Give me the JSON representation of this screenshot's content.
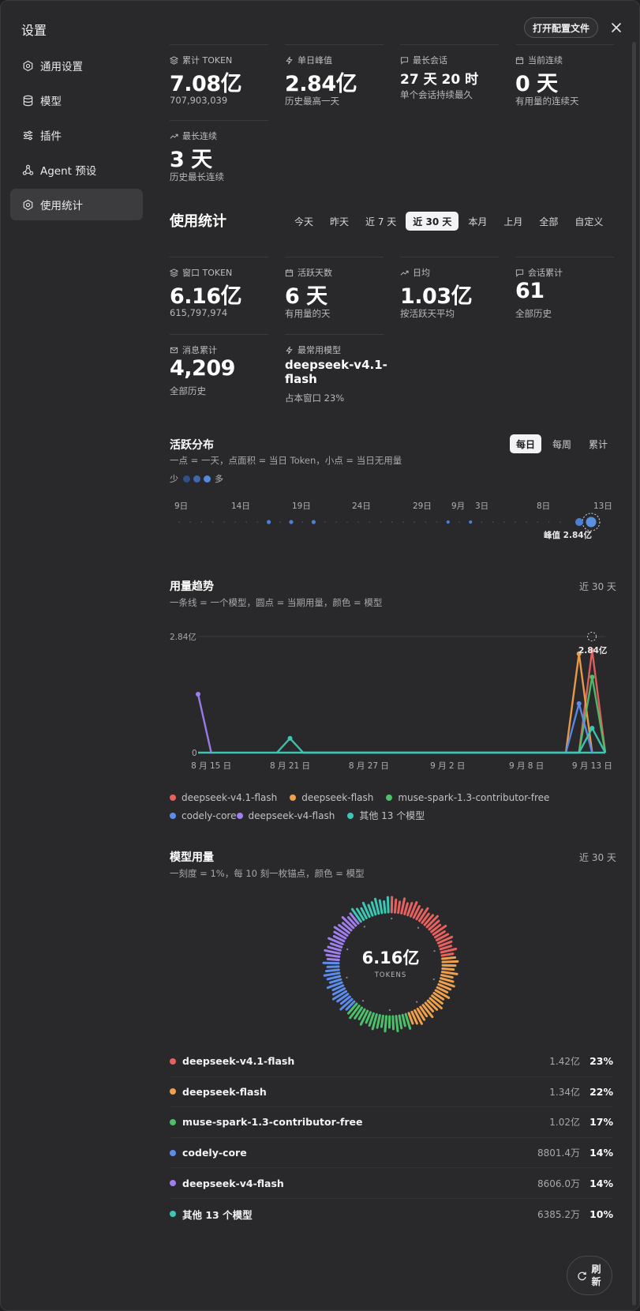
{
  "window": {
    "title": "设置",
    "open_config": "打开配置文件",
    "close_icon": "close-icon"
  },
  "sidebar": {
    "items": [
      {
        "label": "通用设置",
        "icon": "settings-icon",
        "active": false
      },
      {
        "label": "模型",
        "icon": "database-icon",
        "active": false
      },
      {
        "label": "插件",
        "icon": "sliders-icon",
        "active": false
      },
      {
        "label": "Agent 预设",
        "icon": "agent-icon",
        "active": false
      },
      {
        "label": "使用统计",
        "icon": "settings-icon",
        "active": true
      }
    ]
  },
  "totals": {
    "total_token": {
      "label": "累计 TOKEN",
      "value": "7.08亿",
      "sub": "707,903,039",
      "icon": "layers-icon"
    },
    "daily_peak": {
      "label": "单日峰值",
      "value": "2.84亿",
      "sub": "历史最高一天",
      "icon": "bolt-icon"
    },
    "longest_session": {
      "label": "最长会话",
      "value": "27 天 20 时",
      "sub": "单个会话持续最久",
      "icon": "chat-icon"
    },
    "current_streak": {
      "label": "当前连续",
      "value": "0 天",
      "sub": "有用量的连续天",
      "icon": "calendar-icon"
    },
    "longest_streak": {
      "label": "最长连续",
      "value": "3 天",
      "sub": "历史最长连续",
      "icon": "trend-icon"
    }
  },
  "usage": {
    "title": "使用统计",
    "ranges": [
      "今天",
      "昨天",
      "近 7 天",
      "近 30 天",
      "本月",
      "上月",
      "全部",
      "自定义"
    ],
    "active_range": "近 30 天",
    "window_token": {
      "label": "窗口 TOKEN",
      "value": "6.16亿",
      "sub": "615,797,974",
      "icon": "layers-icon"
    },
    "active_days": {
      "label": "活跃天数",
      "value": "6 天",
      "sub": "有用量的天",
      "icon": "calendar-icon"
    },
    "daily_avg": {
      "label": "日均",
      "value": "1.03亿",
      "sub": "按活跃天平均",
      "icon": "trend-icon"
    },
    "sessions": {
      "label": "会话累计",
      "value": "61",
      "sub": "全部历史",
      "icon": "chat-icon"
    },
    "messages": {
      "label": "消息累计",
      "value": "4,209",
      "sub": "全部历史",
      "icon": "mail-icon"
    },
    "top_model": {
      "label": "最常用模型",
      "value_line1": "deepseek-v4.1-",
      "value_line2": "flash",
      "sub": "占本窗口 23%",
      "icon": "bolt-icon"
    }
  },
  "activity": {
    "title": "活跃分布",
    "desc": "一点 = 一天，点面积 = 当日 Token，小点 = 当日无用量",
    "scale_less": "少",
    "scale_more": "多",
    "modes": [
      "每日",
      "每周",
      "累计"
    ],
    "active_mode": "每日",
    "ticks": [
      "9日",
      "14日",
      "19日",
      "24日",
      "29日",
      "9月",
      "3日",
      "8日",
      "13日"
    ],
    "peak_label": "峰值 2.84亿",
    "dot_color": "#4a7fd4"
  },
  "trend": {
    "title": "用量趋势",
    "desc": "一条线 = 一个模型，圆点 = 当期用量，颜色 = 模型",
    "range_note": "近 30 天",
    "y_top": "2.84亿",
    "y_zero": "0",
    "peak_label": "2.84亿",
    "legend": [
      {
        "name": "deepseek-v4.1-flash",
        "color": "#e8615f"
      },
      {
        "name": "deepseek-flash",
        "color": "#f0a04b"
      },
      {
        "name": "muse-spark-1.3-contributor-free",
        "color": "#4cc06b"
      },
      {
        "name": "codely-core",
        "color": "#5b8def"
      },
      {
        "name": "deepseek-v4-flash",
        "color": "#a07ef0"
      },
      {
        "name": "其他 13 个模型",
        "color": "#3cc7b4"
      }
    ]
  },
  "chart_data": {
    "type": "line",
    "x_labels": [
      "8 月 15 日",
      "8 月 21 日",
      "8 月 27 日",
      "9 月 2 日",
      "9 月 8 日",
      "9 月 13 日"
    ],
    "ylim": [
      0,
      284000000
    ],
    "series": [
      {
        "name": "deepseek-v4.1-flash",
        "color": "#e8615f",
        "points": [
          [
            "9 月 12 日",
            0
          ],
          [
            "9 月 13 日",
            250000000
          ],
          [
            "9 月 14 日",
            0
          ]
        ]
      },
      {
        "name": "deepseek-flash",
        "color": "#f0a04b",
        "points": [
          [
            "9 月 11 日",
            0
          ],
          [
            "9 月 12 日",
            242000000
          ],
          [
            "9 月 13 日",
            0
          ]
        ]
      },
      {
        "name": "muse-spark-1.3-contributor-free",
        "color": "#4cc06b",
        "points": [
          [
            "9 月 12 日",
            0
          ],
          [
            "9 月 13 日",
            185000000
          ],
          [
            "9 月 14 日",
            0
          ]
        ]
      },
      {
        "name": "codely-core",
        "color": "#5b8def",
        "points": [
          [
            "9 月 11 日",
            0
          ],
          [
            "9 月 12 日",
            120000000
          ],
          [
            "9 月 13 日",
            0
          ]
        ]
      },
      {
        "name": "deepseek-v4-flash",
        "color": "#a07ef0",
        "points": [
          [
            "8 月 14 日",
            143000000
          ],
          [
            "8 月 15 日",
            0
          ]
        ]
      },
      {
        "name": "其他 13 个模型",
        "color": "#3cc7b4",
        "points": [
          [
            "8 月 20 日",
            0
          ],
          [
            "8 月 21 日",
            35000000
          ],
          [
            "8 月 22 日",
            0
          ],
          [
            "9 月 12 日",
            0
          ],
          [
            "9 月 13 日",
            60000000
          ],
          [
            "9 月 14 日",
            0
          ]
        ]
      }
    ]
  },
  "donut": {
    "title": "模型用量",
    "desc": "一刻度 = 1%，每 10 刻一枚锚点，颜色 = 模型",
    "range_note": "近 30 天",
    "center_value": "6.16亿",
    "center_unit": "TOKENS",
    "segments": [
      {
        "name": "deepseek-v4.1-flash",
        "percent": 23,
        "color": "#e8615f"
      },
      {
        "name": "deepseek-flash",
        "percent": 22,
        "color": "#f0a04b"
      },
      {
        "name": "muse-spark-1.3-contributor-free",
        "percent": 17,
        "color": "#4cc06b"
      },
      {
        "name": "codely-core",
        "percent": 14,
        "color": "#5b8def"
      },
      {
        "name": "deepseek-v4-flash",
        "percent": 14,
        "color": "#a07ef0"
      },
      {
        "name": "其他 13 个模型",
        "percent": 10,
        "color": "#3cc7b4"
      }
    ]
  },
  "models": [
    {
      "name": "deepseek-v4.1-flash",
      "amount": "1.42亿",
      "pct": "23%",
      "color": "#e8615f"
    },
    {
      "name": "deepseek-flash",
      "amount": "1.34亿",
      "pct": "22%",
      "color": "#f0a04b"
    },
    {
      "name": "muse-spark-1.3-contributor-free",
      "amount": "1.02亿",
      "pct": "17%",
      "color": "#4cc06b"
    },
    {
      "name": "codely-core",
      "amount": "8801.4万",
      "pct": "14%",
      "color": "#5b8def"
    },
    {
      "name": "deepseek-v4-flash",
      "amount": "8606.0万",
      "pct": "14%",
      "color": "#a07ef0"
    },
    {
      "name": "其他 13 个模型",
      "amount": "6385.2万",
      "pct": "10%",
      "color": "#3cc7b4"
    }
  ],
  "refresh": {
    "label": "刷新",
    "icon": "refresh-icon"
  }
}
